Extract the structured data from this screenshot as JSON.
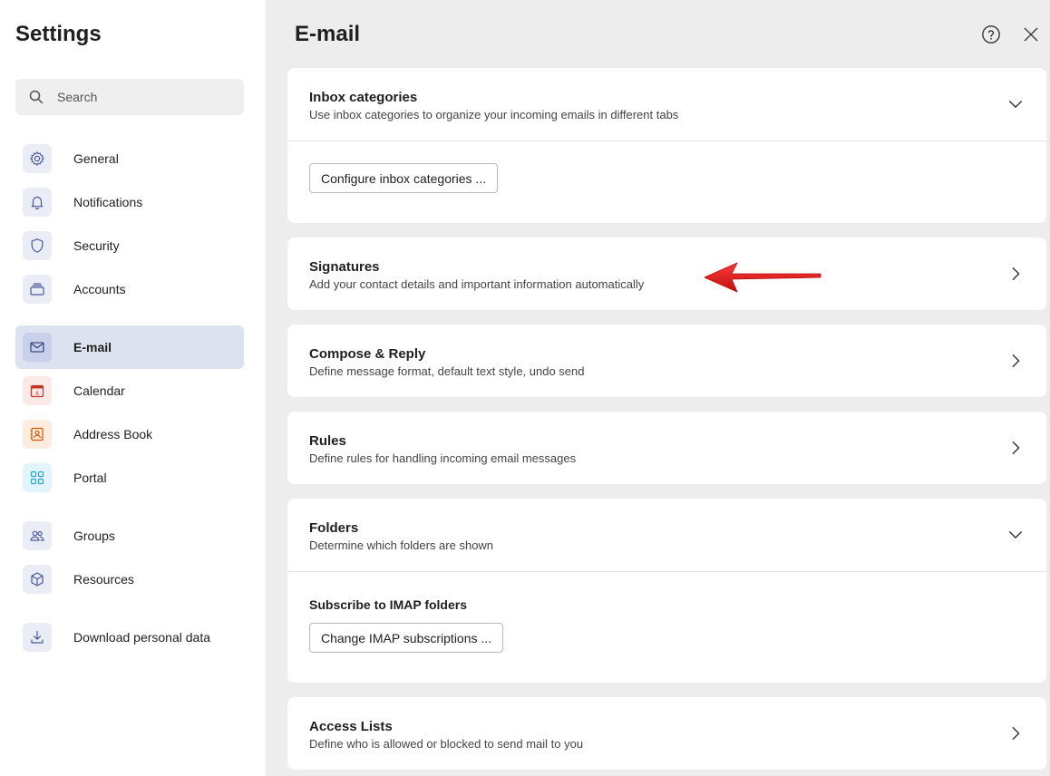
{
  "sidebar": {
    "title": "Settings",
    "search": {
      "placeholder": "Search",
      "icon": "search-icon"
    },
    "items": [
      {
        "label": "General",
        "icon": "gear-icon",
        "color": "#4a5a9a"
      },
      {
        "label": "Notifications",
        "icon": "bell-icon",
        "color": "#4a5a9a"
      },
      {
        "label": "Security",
        "icon": "shield-icon",
        "color": "#4a5a9a"
      },
      {
        "label": "Accounts",
        "icon": "stack-icon",
        "color": "#4a5a9a"
      },
      {
        "label": "E-mail",
        "icon": "envelope-icon",
        "color": "#3a4a8a",
        "active": true
      },
      {
        "label": "Calendar",
        "icon": "calendar-icon",
        "color": "#c0392b",
        "badge": "6"
      },
      {
        "label": "Address Book",
        "icon": "contact-card-icon",
        "color": "#d35400"
      },
      {
        "label": "Portal",
        "icon": "grid-icon",
        "color": "#2aa7c9"
      },
      {
        "label": "Groups",
        "icon": "people-icon",
        "color": "#4a5a9a"
      },
      {
        "label": "Resources",
        "icon": "cube-icon",
        "color": "#4a5a9a"
      },
      {
        "label": "Download personal data",
        "icon": "download-icon",
        "color": "#4a5a9a"
      }
    ]
  },
  "main": {
    "title": "E-mail",
    "help_icon": "help-circle-icon",
    "close_icon": "close-icon",
    "cards": {
      "inbox": {
        "title": "Inbox categories",
        "desc": "Use inbox categories to organize your incoming emails in different tabs",
        "expanded": true,
        "button": "Configure inbox categories ..."
      },
      "signatures": {
        "title": "Signatures",
        "desc": "Add your contact details and important information automatically"
      },
      "compose": {
        "title": "Compose & Reply",
        "desc": "Define message format, default text style, undo send"
      },
      "rules": {
        "title": "Rules",
        "desc": "Define rules for handling incoming email messages"
      },
      "folders": {
        "title": "Folders",
        "desc": "Determine which folders are shown",
        "expanded": true,
        "subtitle": "Subscribe to IMAP folders",
        "button": "Change IMAP subscriptions ..."
      },
      "access": {
        "title": "Access Lists",
        "desc": "Define who is allowed or blocked to send mail to you"
      }
    }
  },
  "annotation": {
    "color": "#e01b1b",
    "type": "arrow-left"
  }
}
